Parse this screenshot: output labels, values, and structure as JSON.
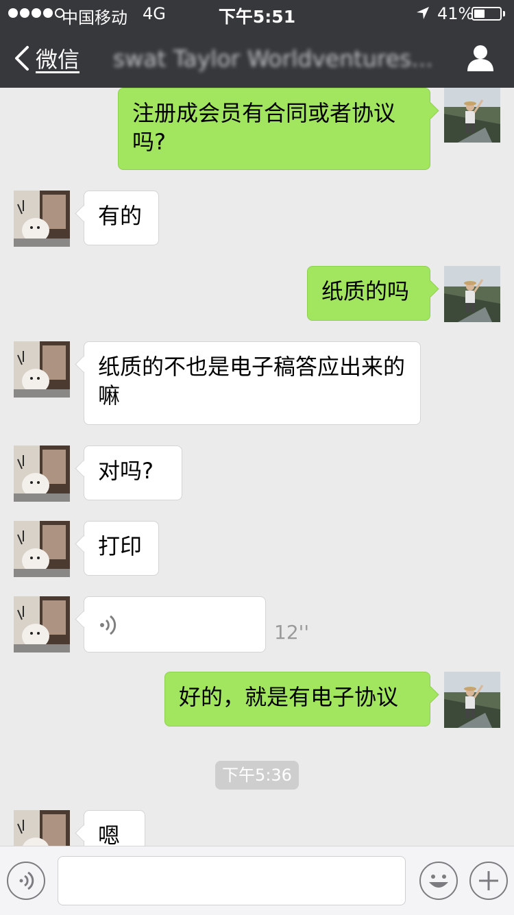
{
  "status": {
    "carrier": "中国移动",
    "network": "4G",
    "time": "下午5:51",
    "battery_percent": "41%",
    "battery_level": 0.41,
    "signal_bars": 4
  },
  "nav": {
    "back_label": "微信",
    "title": "swat Taylor Worldventures..."
  },
  "messages": [
    {
      "side": "out",
      "text": "注册成会员有合同或者协议吗?"
    },
    {
      "side": "in",
      "text": "有的"
    },
    {
      "side": "out",
      "text": "纸质的吗"
    },
    {
      "side": "in",
      "text": "纸质的不也是电子稿答应出来的嘛"
    },
    {
      "side": "in",
      "text": "对吗?"
    },
    {
      "side": "in",
      "text": "打印"
    },
    {
      "side": "in",
      "type": "voice",
      "duration": "12''"
    },
    {
      "side": "out",
      "text": "好的，就是有电子协议"
    },
    {
      "type": "timestamp",
      "text": "下午5:36"
    },
    {
      "side": "in",
      "text": "嗯"
    }
  ],
  "colors": {
    "nav_bg": "#36383c",
    "chat_bg": "#ebebeb",
    "out_bubble": "#a2e55f",
    "in_bubble": "#ffffff"
  },
  "icons": {
    "back": "chevron-left-icon",
    "profile": "person-icon",
    "voice_toggle": "voice-icon",
    "emoji": "smiley-icon",
    "more": "plus-icon"
  },
  "input": {
    "placeholder": ""
  }
}
